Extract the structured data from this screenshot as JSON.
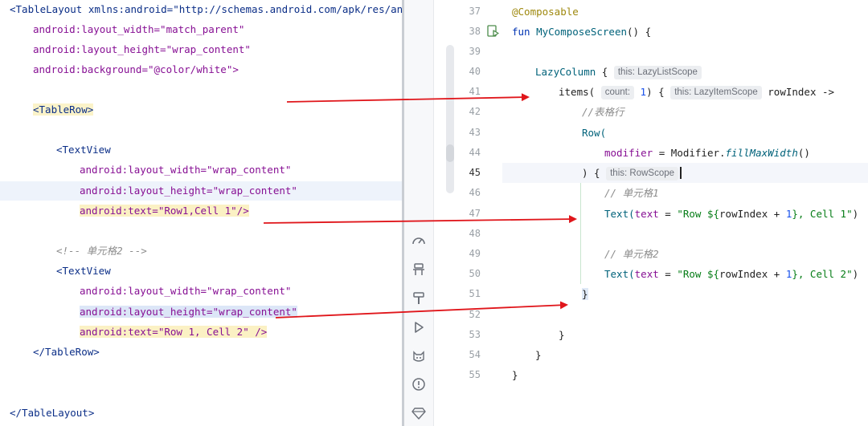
{
  "xml_editor": {
    "lines": [
      "<TableLayout xmlns:android=\"http://schemas.android.com/apk/res/andro",
      "android:layout_width=\"match_parent\"",
      "android:layout_height=\"wrap_content\"",
      "android:background=\"@color/white\">",
      "<TableRow>",
      "<TextView",
      "android:layout_width=\"wrap_content\"",
      "android:layout_height=\"wrap_content\"",
      "android:text=\"Row1,Cell 1\"/>",
      "<!-- 单元格2 -->",
      "<TextView",
      "android:layout_width=\"wrap_content\"",
      "android:layout_height=\"wrap_content\"",
      "android:text=\"Row 1, Cell 2\" />",
      "</TableRow>",
      "</TableLayout>"
    ]
  },
  "compose_editor": {
    "line_numbers": [
      "37",
      "38",
      "39",
      "40",
      "41",
      "42",
      "43",
      "44",
      "45",
      "46",
      "47",
      "48",
      "49",
      "50",
      "51",
      "52",
      "53",
      "54",
      "55"
    ],
    "code": {
      "l37": "@Composable",
      "l38_kw": "fun",
      "l38_name": "MyComposeScreen",
      "l38_rest": "() {",
      "l40_name": "LazyColumn",
      "l40_brace": " {",
      "l40_hint": "this: LazyListScope",
      "l41_name": "items(",
      "l41_hint_count": "count:",
      "l41_count": "1",
      "l41_mid": ") {",
      "l41_hint_scope": "this: LazyItemScope",
      "l41_rest": "rowIndex ->",
      "l42": "//表格行",
      "l43": "Row(",
      "l44_param": "modifier",
      "l44_eq": " = Modifier.",
      "l44_fn": "fillMaxWidth",
      "l44_end": "()",
      "l45_open": ") {",
      "l45_hint": "this: RowScope",
      "l46": "// 单元格1",
      "l47_fn": "Text(",
      "l47_param": "text",
      "l47_eq": " = ",
      "l47_str1": "\"Row ${",
      "l47_var": "rowIndex + ",
      "l47_num": "1",
      "l47_str2": "}, Cell 1\"",
      "l47_end": ")",
      "l49": "// 单元格2",
      "l50_fn": "Text(",
      "l50_param": "text",
      "l50_eq": " = ",
      "l50_str1": "\"Row ${",
      "l50_var": "rowIndex + ",
      "l50_num": "1",
      "l50_str2": "}, Cell 2\"",
      "l50_end": ")",
      "l51": "}",
      "l53": "}",
      "l54": "}",
      "l55": "}"
    }
  },
  "side_toolbar": {
    "icons": [
      "speedometer-icon",
      "profiler-icon",
      "hammer-icon",
      "run-icon",
      "cat-icon",
      "warning-icon",
      "gem-icon"
    ]
  },
  "colors": {
    "arrow": "#e0161b",
    "keyword": "#0033b3",
    "string": "#067d17",
    "attribute": "#871094"
  }
}
